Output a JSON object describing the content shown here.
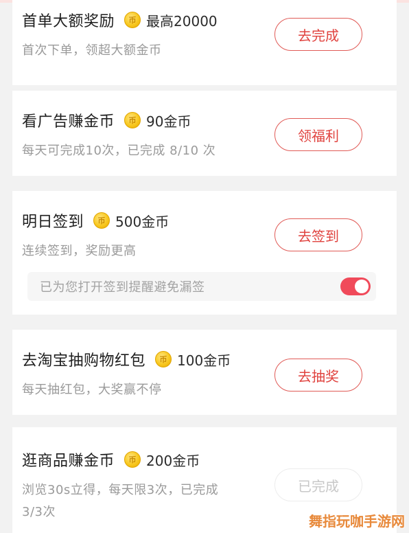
{
  "tasks": [
    {
      "title": "首单大额奖励",
      "reward": "最高20000",
      "desc": "首次下单，领超大额金币",
      "button": "去完成"
    },
    {
      "title": "看广告赚金币",
      "reward": "90金币",
      "desc": "每天可完成10次，已完成  8/10  次",
      "button": "领福利"
    },
    {
      "title": "明日签到",
      "reward": "500金币",
      "desc": "连续签到，奖励更高",
      "button": "去签到"
    },
    {
      "title": "去淘宝抽购物红包",
      "reward": "100金币",
      "desc": "每天抽红包，大奖赢不停",
      "button": "去抽奖"
    },
    {
      "title": "逛商品赚金币",
      "reward": "200金币",
      "desc_line1": "浏览30s立得，每天限3次，已完成",
      "desc_line2": "3/3次",
      "button": "已完成"
    }
  ],
  "reminder": {
    "text": "已为您打开签到提醒避免漏签",
    "enabled": true
  },
  "coin_glyph": "币",
  "watermark": "舞指玩咖手游网",
  "colors": {
    "accent": "#e0433f",
    "toggle_on": "#f04a5a",
    "coin": "#f8c820"
  }
}
